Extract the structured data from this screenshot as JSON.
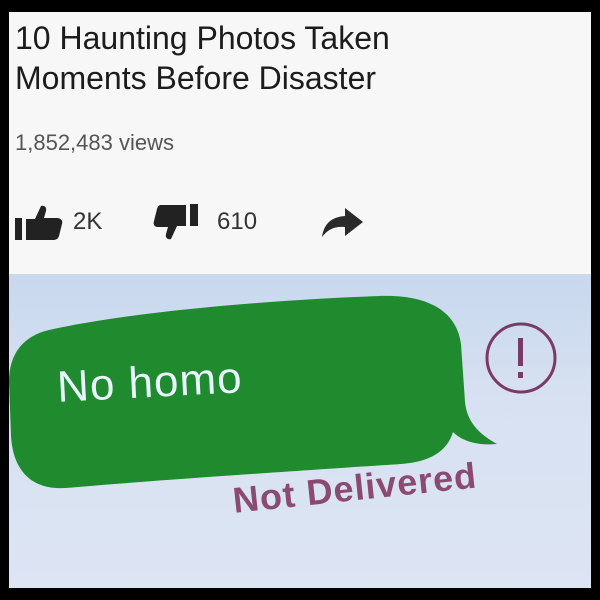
{
  "video": {
    "title_line1": "10 Haunting Photos Taken",
    "title_line2": "Moments Before Disaster",
    "views": "1,852,483 views",
    "likes": "2K",
    "dislikes": "610",
    "icons": {
      "like": "thumbs-up-icon",
      "dislike": "thumbs-down-icon",
      "share": "share-arrow-icon"
    }
  },
  "message": {
    "text": "No homo",
    "status": "Not Delivered",
    "alert_icon": "exclamation-circle-icon",
    "bubble_color": "#1f8a2e",
    "text_color": "#e9f5ff",
    "status_color": "#8a4a72"
  }
}
